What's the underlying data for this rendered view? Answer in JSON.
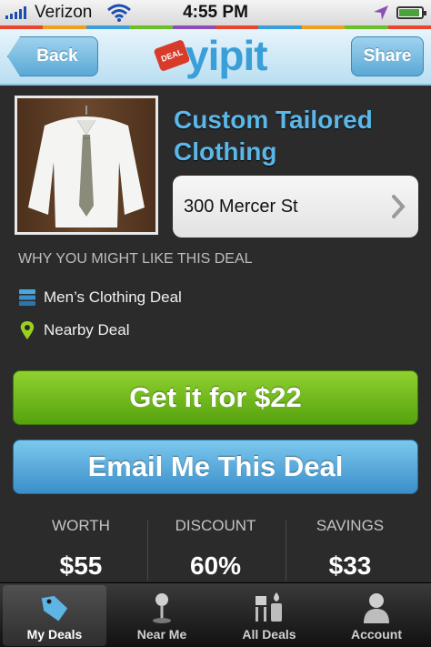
{
  "status_bar": {
    "carrier": "Verizon",
    "time": "4:55 PM",
    "battery_level": 0.85
  },
  "stripe_colors": [
    "#e8462e",
    "#f0a020",
    "#3a9fd8",
    "#6bbf2a",
    "#8a4fb8",
    "#e8462e",
    "#3a9fd8",
    "#f0a020",
    "#6bbf2a",
    "#e8462e"
  ],
  "header": {
    "back_label": "Back",
    "share_label": "Share",
    "logo_text": "yipit",
    "logo_tag": "DEAL"
  },
  "deal": {
    "title": "Custom Tailored Clothing",
    "address": "300 Mercer St",
    "why_heading": "WHY YOU MIGHT LIKE THIS DEAL",
    "reasons": [
      {
        "label": "Men’s Clothing Deal",
        "icon": "stack-icon"
      },
      {
        "label": "Nearby Deal",
        "icon": "map-pin-icon"
      }
    ],
    "buy_label": "Get it for $22",
    "email_label": "Email Me This Deal",
    "stats": [
      {
        "label": "WORTH",
        "value": "$55"
      },
      {
        "label": "DISCOUNT",
        "value": "60%"
      },
      {
        "label": "SAVINGS",
        "value": "$33"
      }
    ]
  },
  "tabs": [
    {
      "label": "My Deals",
      "icon": "tag-icon",
      "active": true
    },
    {
      "label": "Near Me",
      "icon": "pin-icon",
      "active": false
    },
    {
      "label": "All Deals",
      "icon": "deals-icon",
      "active": false
    },
    {
      "label": "Account",
      "icon": "person-icon",
      "active": false
    }
  ],
  "colors": {
    "accent_blue": "#5bb7e8",
    "buy_green": "#6ab51c",
    "background": "#2b2b2b"
  }
}
